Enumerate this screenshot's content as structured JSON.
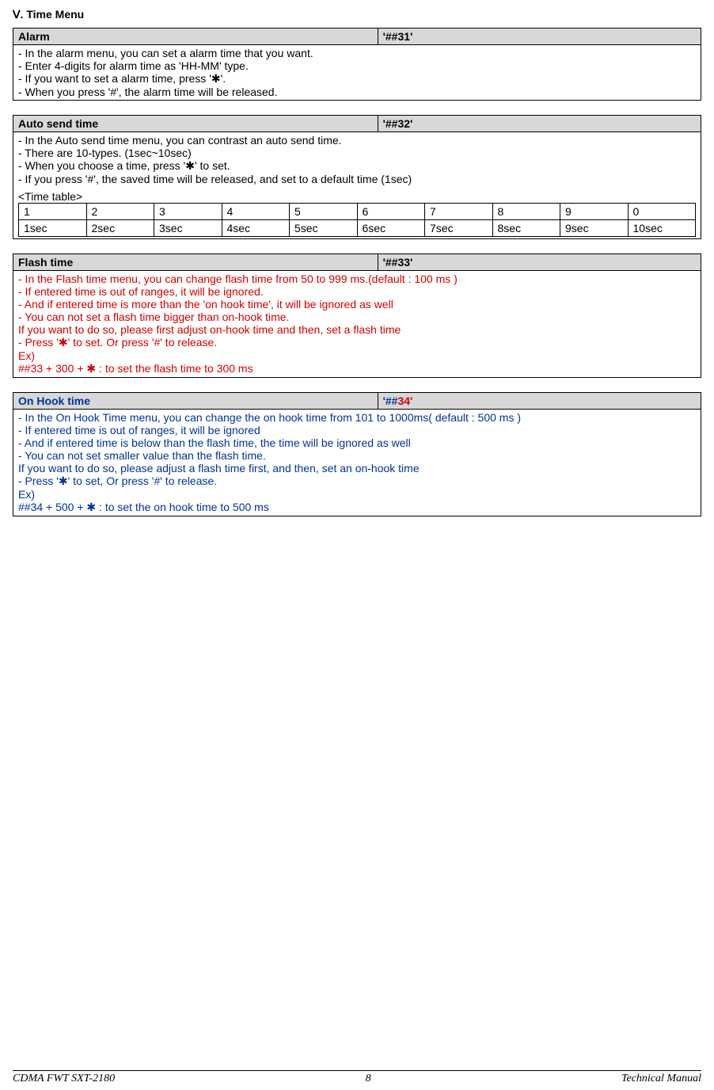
{
  "section_title": "Ⅴ. Time Menu",
  "alarm": {
    "title": "Alarm",
    "code": "'##31'",
    "lines": [
      "- In the alarm menu, you can set a alarm time that you want.",
      "- Enter 4-digits for alarm time as 'HH-MM' type.",
      "- If you want to set a alarm time, press '✱'.",
      "- When you press '#', the alarm time will be released."
    ]
  },
  "autosend": {
    "title": "Auto send time",
    "code": "'##32'",
    "lines": [
      "- In the Auto send time menu, you can contrast an auto send time.",
      "- There are 10-types. (1sec~10sec)",
      "- When you choose a time, press '✱' to set.",
      "- If you press '#', the saved time will be released, and set to a default time (1sec)"
    ],
    "time_table_label": "<Time table>",
    "time_table_header": [
      "1",
      "2",
      "3",
      "4",
      "5",
      "6",
      "7",
      "8",
      "9",
      "0"
    ],
    "time_table_values": [
      "1sec",
      "2sec",
      "3sec",
      "4sec",
      "5sec",
      "6sec",
      "7sec",
      "8sec",
      "9sec",
      "10sec"
    ]
  },
  "flashtime": {
    "title": "Flash time",
    "code": "'##33'",
    "lines": [
      "- In the Flash time menu, you can change flash time from 50 to 999 ms.(default : 100 ms )",
      "- If entered time is out of ranges, it will be ignored.",
      "- And if entered time is more than the 'on hook time', it will be ignored as well",
      "- You can not set a flash time bigger than on-hook time.",
      "  If you want to do so, please first adjust on-hook time and then, set a flash time",
      "- Press '✱' to set. Or press '#' to release.",
      "Ex)",
      "##33 + 300 + ✱ : to set the flash time to 300 ms"
    ]
  },
  "onhook": {
    "title": "On Hook time",
    "code_pre": "'##",
    "code_num": "34'",
    "lines": [
      "- In the On Hook Time menu, you can change the on hook time from 101 to 1000ms( default : 500 ms )",
      "- If entered time is out of ranges, it will be ignored",
      "- And if entered time is below than the flash time, the time will be ignored as well",
      "- You can not set smaller value than the flash time.",
      "  If you want to do so, please adjust a flash time first, and then, set an on-hook time",
      "- Press '✱' to set, Or press '#' to release.",
      "Ex)",
      "##34 + 500 + ✱ : to set the on hook time to 500 ms"
    ]
  },
  "footer": {
    "left": "CDMA FWT SXT-2180",
    "center": "8",
    "right": "Technical Manual"
  }
}
